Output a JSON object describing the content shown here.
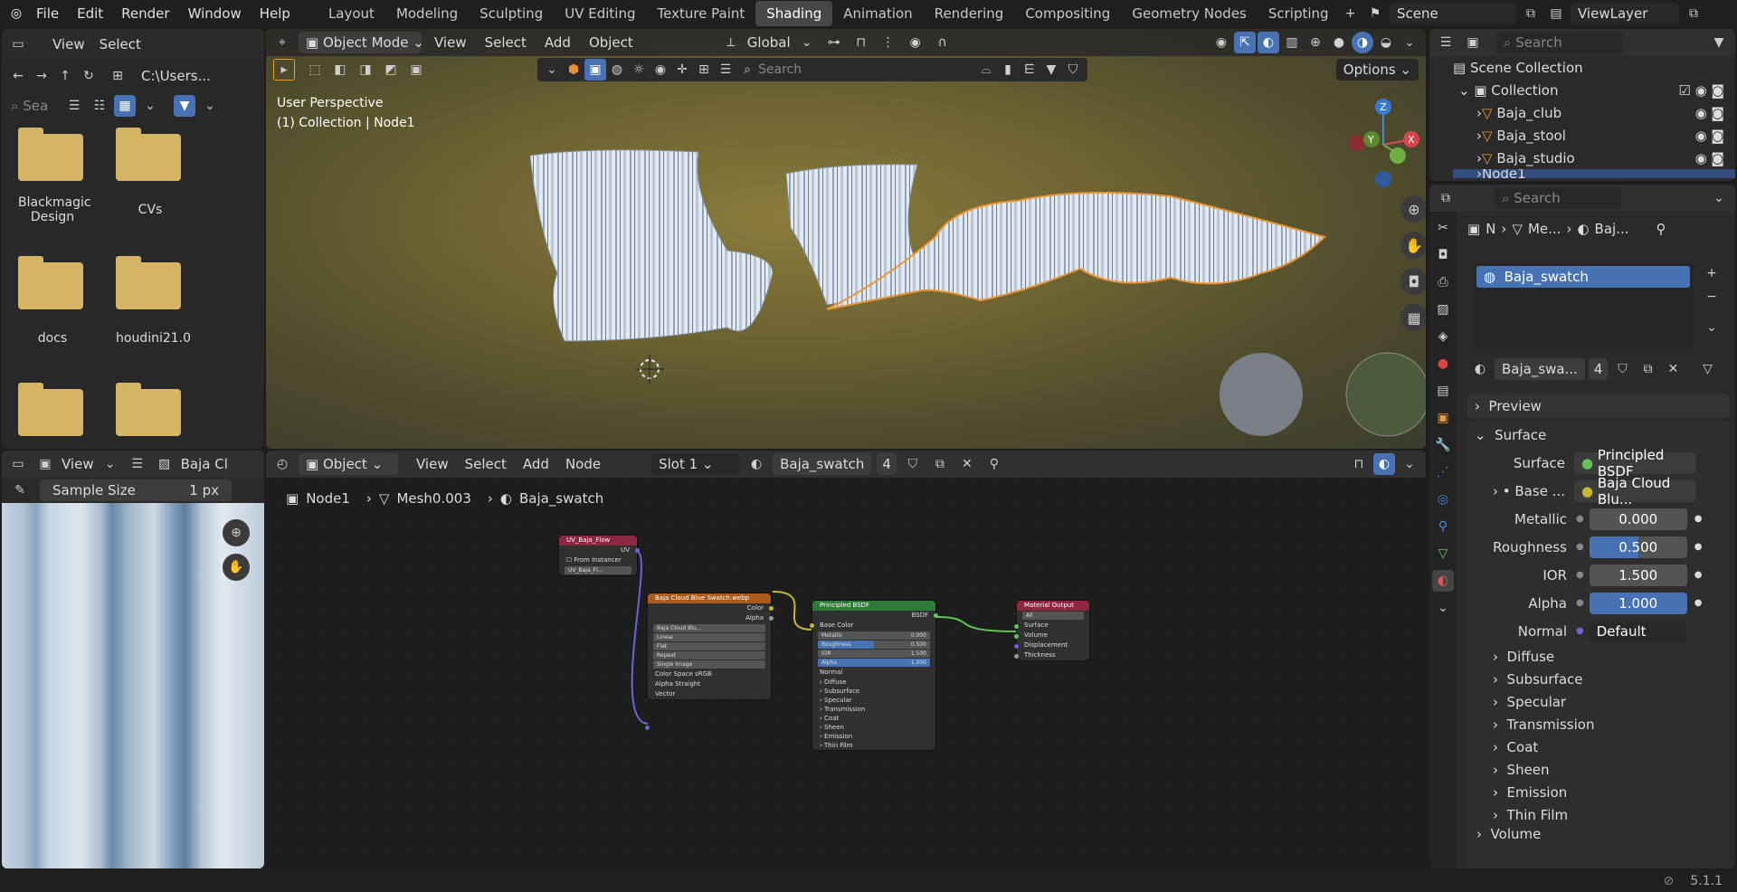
{
  "menus": [
    "File",
    "Edit",
    "Render",
    "Window",
    "Help"
  ],
  "workspaces": [
    "Layout",
    "Modeling",
    "Sculpting",
    "UV Editing",
    "Texture Paint",
    "Shading",
    "Animation",
    "Rendering",
    "Compositing",
    "Geometry Nodes",
    "Scripting"
  ],
  "active_workspace": "Shading",
  "scene": "Scene",
  "view_layer": "ViewLayer",
  "file_browser": {
    "view": "View",
    "select": "Select",
    "path": "C:\\Users...",
    "search_placeholder": "Sea",
    "folders": [
      "Blackmagic Design",
      "CVs",
      "docs",
      "houdini21.0"
    ]
  },
  "viewport": {
    "mode": "Object Mode",
    "menus": [
      "View",
      "Select",
      "Add",
      "Object"
    ],
    "transform": "Global",
    "search_placeholder": "Search",
    "options": "Options",
    "info1": "User Perspective",
    "info2": "(1) Collection | Node1",
    "gizmo": {
      "z": "Z",
      "y": "Y",
      "x": "X"
    }
  },
  "image_editor": {
    "view": "View",
    "image": "Baja Cl",
    "sample_label": "Sample Size",
    "sample_value": "1 px"
  },
  "node_editor": {
    "type": "Object",
    "menus": [
      "View",
      "Select",
      "Add",
      "Node"
    ],
    "slot": "Slot 1",
    "material": "Baja_swatch",
    "users": "4",
    "breadcrumb": [
      "Node1",
      "Mesh0.003",
      "Baja_swatch"
    ],
    "nodes": {
      "uv": {
        "title": "UV_Baja_Flow",
        "out": "UV",
        "check": "From Instancer",
        "field": "UV_Baja_Fl..."
      },
      "img": {
        "title": "Baja Cloud Blue Swatch.webp",
        "out1": "Color",
        "out2": "Alpha",
        "name": "Baja Cloud Blu...",
        "interp": "Linear",
        "proj": "Flat",
        "ext": "Repeat",
        "src": "Single Image",
        "cs_label": "Color Space",
        "cs": "sRGB",
        "alpha_label": "Alpha",
        "alpha": "Straight",
        "in": "Vector"
      },
      "bsdf": {
        "title": "Principled BSDF",
        "out": "BSDF",
        "base": "Base Color",
        "rows": [
          [
            "Metallic",
            "0.000"
          ],
          [
            "Roughness",
            "0.500"
          ],
          [
            "IOR",
            "1.500"
          ],
          [
            "Alpha",
            "1.000"
          ]
        ],
        "normal": "Normal",
        "subs": [
          "Diffuse",
          "Subsurface",
          "Specular",
          "Transmission",
          "Coat",
          "Sheen",
          "Emission",
          "Thin Film"
        ]
      },
      "out": {
        "title": "Material Output",
        "target": "All",
        "ins": [
          "Surface",
          "Volume",
          "Displacement",
          "Thickness"
        ]
      }
    }
  },
  "outliner": {
    "search_placeholder": "Search",
    "root": "Scene Collection",
    "collection": "Collection",
    "items": [
      "Baja_club",
      "Baja_stool",
      "Baja_studio",
      "Node1"
    ]
  },
  "properties": {
    "search_placeholder": "Search",
    "crumb": [
      "N",
      "Me...",
      "Baj..."
    ],
    "slot_item": "Baja_swatch",
    "material": "Baja_swa...",
    "users": "4",
    "preview": "Preview",
    "surface_header": "Surface",
    "surface_label": "Surface",
    "surface_value": "Principled BSDF",
    "base_label": "Base ...",
    "base_value": "Baja Cloud Blu...",
    "rows": [
      {
        "label": "Metallic",
        "value": "0.000",
        "fill": 0.0
      },
      {
        "label": "Roughness",
        "value": "0.500",
        "fill": 0.5
      },
      {
        "label": "IOR",
        "value": "1.500",
        "fill": 0
      },
      {
        "label": "Alpha",
        "value": "1.000",
        "fill": 1.0
      }
    ],
    "normal_label": "Normal",
    "normal_value": "Default",
    "subpanels": [
      "Diffuse",
      "Subsurface",
      "Specular",
      "Transmission",
      "Coat",
      "Sheen",
      "Emission",
      "Thin Film"
    ],
    "volume": "Volume"
  },
  "version": "5.1.1"
}
